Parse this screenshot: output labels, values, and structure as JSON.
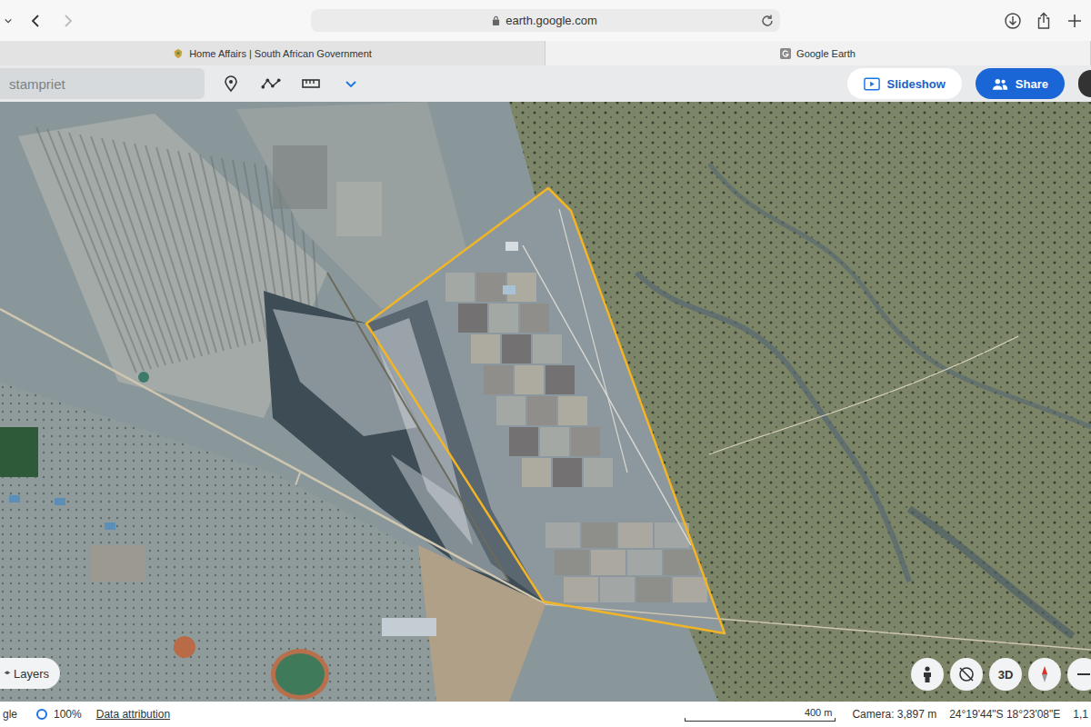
{
  "browser": {
    "url": "earth.google.com",
    "tabs": [
      {
        "label": "Home Affairs | South African Government",
        "selected": false
      },
      {
        "label": "Google Earth",
        "selected": true
      }
    ]
  },
  "toolbar": {
    "search": "stampriet",
    "buttons": [
      {
        "label": "Slideshow",
        "kind": "secondary"
      },
      {
        "label": "Share",
        "kind": "primary"
      }
    ]
  },
  "map": {
    "layers_button": "Layers",
    "view_button": "3D"
  },
  "status_bar": {
    "brand": "gle",
    "zoom": "100%",
    "attribution": "Data attribution",
    "scale": "400 m",
    "camera": "Camera: 3,897 m",
    "coordinates": "24°19'44\"S 18°23'08\"E",
    "extra": "1,1"
  }
}
